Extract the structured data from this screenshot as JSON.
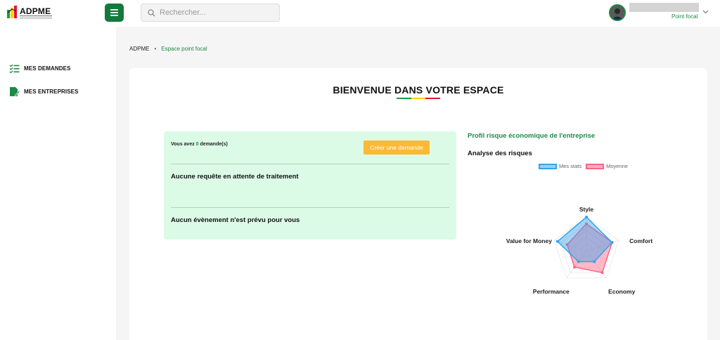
{
  "brand": {
    "name": "ADPME"
  },
  "search": {
    "placeholder": "Rechercher..."
  },
  "user": {
    "role": "Point focal"
  },
  "sidebar": {
    "items": [
      {
        "label": "MES DEMANDES"
      },
      {
        "label": "MES ENTREPRISES"
      }
    ]
  },
  "breadcrumb": {
    "root": "ADPME",
    "current": "Espace point focal"
  },
  "welcome": {
    "title": "BIENVENUE DANS VOTRE ESPACE"
  },
  "requests": {
    "prefix": "Vous avez ",
    "count": "0",
    "suffix": " demande(s)",
    "create_label": "Créer une demande",
    "no_pending": "Aucune requête en attente de traitement",
    "no_events": "Aucun évènement n'est prévu pour vous"
  },
  "risk": {
    "title": "Profil risque économique de l'entreprise",
    "chart_title": "Analyse des risques"
  },
  "colors": {
    "primary_green": "#1d8a45",
    "button_orange": "#fbb934",
    "info_bg": "#dcfbe6",
    "series_mine": "#36a2eb",
    "series_avg": "#ff6384",
    "flag": [
      "#1a9b48",
      "#fcd116",
      "#e8112d"
    ]
  },
  "icons": {
    "menu": "hamburger-icon",
    "search": "search-icon",
    "chevron": "chevron-down-icon",
    "demandes": "checklist-icon",
    "entreprises": "edit-document-icon"
  },
  "chart_data": {
    "type": "radar",
    "title": "Analyse des risques",
    "categories": [
      "Style",
      "Comfort",
      "Economy",
      "Performance",
      "Value for Money"
    ],
    "rmax": 5,
    "series": [
      {
        "name": "Mes stats",
        "color": "#36a2eb",
        "values": [
          5,
          4,
          2,
          2,
          4.5
        ]
      },
      {
        "name": "Moyenne",
        "color": "#ff6384",
        "values": [
          4,
          4,
          4,
          3,
          3
        ]
      }
    ],
    "legend": "top"
  }
}
